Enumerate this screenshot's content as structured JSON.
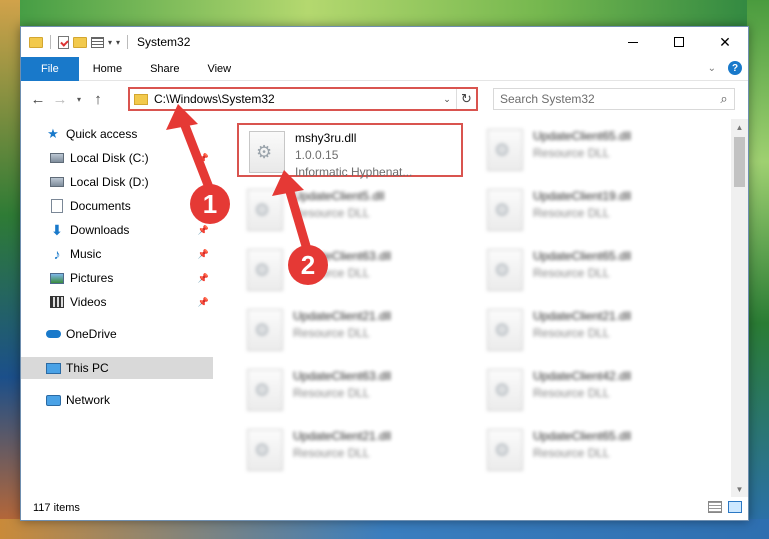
{
  "window": {
    "title": "System32",
    "minimize_icon": "minimize-icon",
    "maximize_icon": "maximize-icon",
    "close_label": "✕"
  },
  "ribbon": {
    "tabs": [
      "File",
      "Home",
      "Share",
      "View"
    ],
    "help_label": "?"
  },
  "navigation": {
    "back_label": "←",
    "forward_label": "→",
    "recent_label": "▾",
    "up_label": "↑",
    "address_path": "C:\\Windows\\System32",
    "refresh_label": "↻",
    "search_placeholder": "Search System32"
  },
  "sidebar": {
    "items": [
      {
        "label": "Quick access",
        "icon": "star-icon"
      },
      {
        "label": "Local Disk (C:)",
        "icon": "disk-icon"
      },
      {
        "label": "Local Disk (D:)",
        "icon": "disk-icon"
      },
      {
        "label": "Documents",
        "icon": "documents-icon"
      },
      {
        "label": "Downloads",
        "icon": "download-icon"
      },
      {
        "label": "Music",
        "icon": "music-icon"
      },
      {
        "label": "Pictures",
        "icon": "pictures-icon"
      },
      {
        "label": "Videos",
        "icon": "videos-icon"
      },
      {
        "label": "OneDrive",
        "icon": "cloud-icon"
      },
      {
        "label": "This PC",
        "icon": "computer-icon"
      },
      {
        "label": "Network",
        "icon": "network-icon"
      }
    ]
  },
  "files": {
    "highlighted": {
      "name": "mshy3ru.dll",
      "version": "1.0.0.15",
      "description": "Informatic Hyphenat..."
    },
    "left_column": [
      {
        "name": "UpdateClient5.dll",
        "description": "Resource DLL"
      },
      {
        "name": "UpdateClient63.dll",
        "description": "Resource DLL"
      },
      {
        "name": "UpdateClient21.dll",
        "description": "Resource DLL"
      },
      {
        "name": "UpdateClient63.dll",
        "description": "Resource DLL"
      },
      {
        "name": "UpdateClient21.dll",
        "description": "Resource DLL"
      }
    ],
    "right_column": [
      {
        "name": "UpdateClient65.dll",
        "description": "Resource DLL"
      },
      {
        "name": "UpdateClient19.dll",
        "description": "Resource DLL"
      },
      {
        "name": "UpdateClient65.dll",
        "description": "Resource DLL"
      },
      {
        "name": "UpdateClient21.dll",
        "description": "Resource DLL"
      },
      {
        "name": "UpdateClient42.dll",
        "description": "Resource DLL"
      },
      {
        "name": "UpdateClient65.dll",
        "description": "Resource DLL"
      }
    ]
  },
  "status": {
    "item_count": "117 items"
  },
  "annotations": {
    "step1": "1",
    "step2": "2",
    "color": "#e53935"
  }
}
